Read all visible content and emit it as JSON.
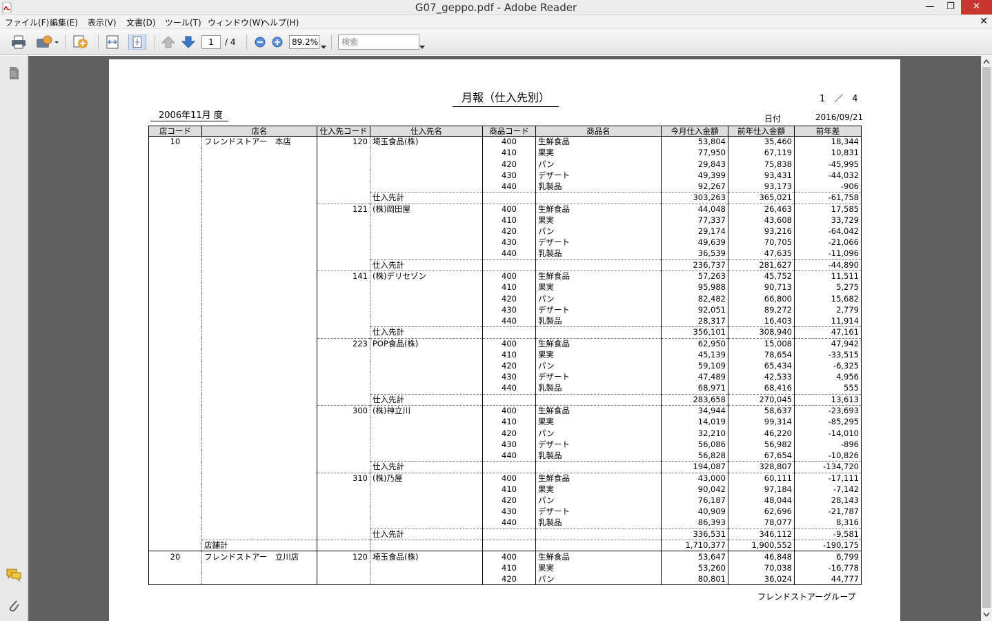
{
  "window": {
    "title": "G07_geppo.pdf - Adobe Reader"
  },
  "menu": {
    "items": [
      "ファイル(F)",
      "編集(E)",
      "表示(V)",
      "文書(D)",
      "ツール(T)",
      "ウィンドウ(W)",
      "ヘルプ(H)"
    ]
  },
  "toolbar": {
    "page_current": "1",
    "page_total": "/ 4",
    "zoom": "89.2%",
    "search_placeholder": "検索"
  },
  "report": {
    "title": "月報（仕入先別）",
    "page_indicator": "1　／　4",
    "period": "2006年11月 度",
    "date_label": "日付",
    "date_value": "2016/09/21",
    "footer": "フレンドストアーグループ",
    "headers": [
      "店コード",
      "店名",
      "仕入先コード",
      "仕入先名",
      "商品コード",
      "商品名",
      "今月仕入金額",
      "前年仕入金額",
      "前年差"
    ],
    "rows": [
      {
        "t": "item",
        "store_code": "10",
        "store_name": "フレンドストアー　本店",
        "sup_code": "120",
        "sup_name": "埼玉食品(株)",
        "code": "400",
        "prod": "生鮮食品",
        "cur": "53,804",
        "prev": "35,460",
        "diff": "18,344"
      },
      {
        "t": "item",
        "code": "410",
        "prod": "果実",
        "cur": "77,950",
        "prev": "67,119",
        "diff": "10,831"
      },
      {
        "t": "item",
        "code": "420",
        "prod": "パン",
        "cur": "29,843",
        "prev": "75,838",
        "diff": "-45,995"
      },
      {
        "t": "item",
        "code": "430",
        "prod": "デザート",
        "cur": "49,399",
        "prev": "93,431",
        "diff": "-44,032"
      },
      {
        "t": "item",
        "code": "440",
        "prod": "乳製品",
        "cur": "92,267",
        "prev": "93,173",
        "diff": "-906"
      },
      {
        "t": "sub",
        "label": "仕入先計",
        "cur": "303,263",
        "prev": "365,021",
        "diff": "-61,758"
      },
      {
        "t": "item",
        "sup_code": "121",
        "sup_name": "(株)岡田屋",
        "code": "400",
        "prod": "生鮮食品",
        "cur": "44,048",
        "prev": "26,463",
        "diff": "17,585"
      },
      {
        "t": "item",
        "code": "410",
        "prod": "果実",
        "cur": "77,337",
        "prev": "43,608",
        "diff": "33,729"
      },
      {
        "t": "item",
        "code": "420",
        "prod": "パン",
        "cur": "29,174",
        "prev": "93,216",
        "diff": "-64,042"
      },
      {
        "t": "item",
        "code": "430",
        "prod": "デザート",
        "cur": "49,639",
        "prev": "70,705",
        "diff": "-21,066"
      },
      {
        "t": "item",
        "code": "440",
        "prod": "乳製品",
        "cur": "36,539",
        "prev": "47,635",
        "diff": "-11,096"
      },
      {
        "t": "sub",
        "label": "仕入先計",
        "cur": "236,737",
        "prev": "281,627",
        "diff": "-44,890"
      },
      {
        "t": "item",
        "sup_code": "141",
        "sup_name": "(株)デリセゾン",
        "code": "400",
        "prod": "生鮮食品",
        "cur": "57,263",
        "prev": "45,752",
        "diff": "11,511"
      },
      {
        "t": "item",
        "code": "410",
        "prod": "果実",
        "cur": "95,988",
        "prev": "90,713",
        "diff": "5,275"
      },
      {
        "t": "item",
        "code": "420",
        "prod": "パン",
        "cur": "82,482",
        "prev": "66,800",
        "diff": "15,682"
      },
      {
        "t": "item",
        "code": "430",
        "prod": "デザート",
        "cur": "92,051",
        "prev": "89,272",
        "diff": "2,779"
      },
      {
        "t": "item",
        "code": "440",
        "prod": "乳製品",
        "cur": "28,317",
        "prev": "16,403",
        "diff": "11,914"
      },
      {
        "t": "sub",
        "label": "仕入先計",
        "cur": "356,101",
        "prev": "308,940",
        "diff": "47,161"
      },
      {
        "t": "item",
        "sup_code": "223",
        "sup_name": "POP食品(株)",
        "code": "400",
        "prod": "生鮮食品",
        "cur": "62,950",
        "prev": "15,008",
        "diff": "47,942"
      },
      {
        "t": "item",
        "code": "410",
        "prod": "果実",
        "cur": "45,139",
        "prev": "78,654",
        "diff": "-33,515"
      },
      {
        "t": "item",
        "code": "420",
        "prod": "パン",
        "cur": "59,109",
        "prev": "65,434",
        "diff": "-6,325"
      },
      {
        "t": "item",
        "code": "430",
        "prod": "デザート",
        "cur": "47,489",
        "prev": "42,533",
        "diff": "4,956"
      },
      {
        "t": "item",
        "code": "440",
        "prod": "乳製品",
        "cur": "68,971",
        "prev": "68,416",
        "diff": "555"
      },
      {
        "t": "sub",
        "label": "仕入先計",
        "cur": "283,658",
        "prev": "270,045",
        "diff": "13,613"
      },
      {
        "t": "item",
        "sup_code": "300",
        "sup_name": "(株)神立川",
        "code": "400",
        "prod": "生鮮食品",
        "cur": "34,944",
        "prev": "58,637",
        "diff": "-23,693"
      },
      {
        "t": "item",
        "code": "410",
        "prod": "果実",
        "cur": "14,019",
        "prev": "99,314",
        "diff": "-85,295"
      },
      {
        "t": "item",
        "code": "420",
        "prod": "パン",
        "cur": "32,210",
        "prev": "46,220",
        "diff": "-14,010"
      },
      {
        "t": "item",
        "code": "430",
        "prod": "デザート",
        "cur": "56,086",
        "prev": "56,982",
        "diff": "-896"
      },
      {
        "t": "item",
        "code": "440",
        "prod": "乳製品",
        "cur": "56,828",
        "prev": "67,654",
        "diff": "-10,826"
      },
      {
        "t": "sub",
        "label": "仕入先計",
        "cur": "194,087",
        "prev": "328,807",
        "diff": "-134,720"
      },
      {
        "t": "item",
        "sup_code": "310",
        "sup_name": "(株)乃屋",
        "code": "400",
        "prod": "生鮮食品",
        "cur": "43,000",
        "prev": "60,111",
        "diff": "-17,111"
      },
      {
        "t": "item",
        "code": "410",
        "prod": "果実",
        "cur": "90,042",
        "prev": "97,184",
        "diff": "-7,142"
      },
      {
        "t": "item",
        "code": "420",
        "prod": "パン",
        "cur": "76,187",
        "prev": "48,044",
        "diff": "28,143"
      },
      {
        "t": "item",
        "code": "430",
        "prod": "デザート",
        "cur": "40,909",
        "prev": "62,696",
        "diff": "-21,787"
      },
      {
        "t": "item",
        "code": "440",
        "prod": "乳製品",
        "cur": "86,393",
        "prev": "78,077",
        "diff": "8,316"
      },
      {
        "t": "sub",
        "label": "仕入先計",
        "cur": "336,531",
        "prev": "346,112",
        "diff": "-9,581"
      },
      {
        "t": "tot",
        "label": "店舗計",
        "cur": "1,710,377",
        "prev": "1,900,552",
        "diff": "-190,175"
      },
      {
        "t": "item",
        "grp": true,
        "store_code": "20",
        "store_name": "フレンドストアー　立川店",
        "sup_code": "120",
        "sup_name": "埼玉食品(株)",
        "code": "400",
        "prod": "生鮮食品",
        "cur": "53,647",
        "prev": "46,848",
        "diff": "6,799"
      },
      {
        "t": "item",
        "code": "410",
        "prod": "果実",
        "cur": "53,260",
        "prev": "70,038",
        "diff": "-16,778"
      },
      {
        "t": "item",
        "last": true,
        "code": "420",
        "prod": "パン",
        "cur": "80,801",
        "prev": "36,024",
        "diff": "44,777"
      }
    ]
  }
}
